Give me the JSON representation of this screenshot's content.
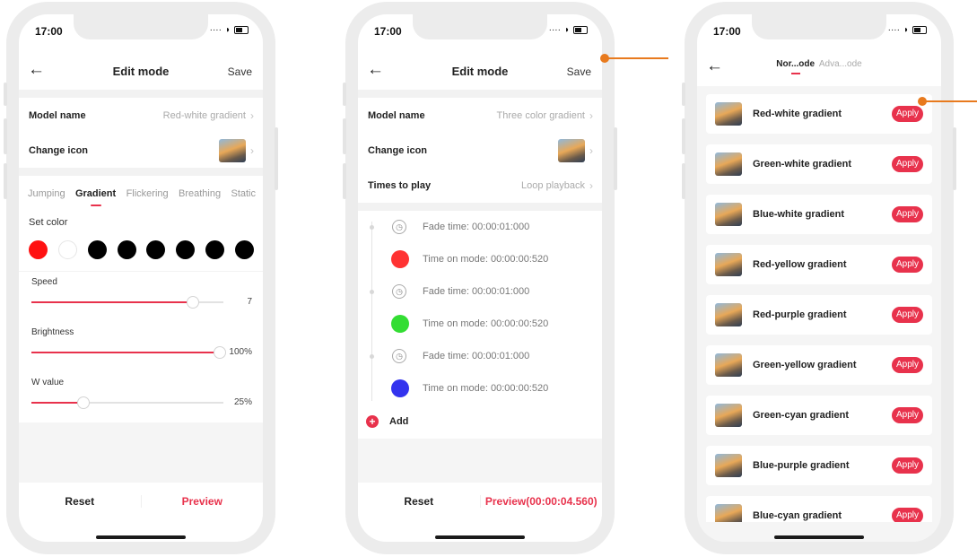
{
  "status": {
    "time": "17:00"
  },
  "phone1": {
    "nav": {
      "back": "←",
      "title": "Edit mode",
      "save": "Save"
    },
    "model_name": {
      "label": "Model name",
      "value": "Red-white gradient"
    },
    "change_icon": {
      "label": "Change icon"
    },
    "tabs": [
      "Jumping",
      "Gradient",
      "Flickering",
      "Breathing",
      "Static"
    ],
    "active_tab": "Gradient",
    "set_color": {
      "label": "Set color",
      "colors": [
        "#ff1111",
        "#ffffff",
        "#000000",
        "#000000",
        "#000000",
        "#000000",
        "#000000",
        "#000000"
      ]
    },
    "speed": {
      "label": "Speed",
      "value": "7",
      "level": 0.84
    },
    "brightness": {
      "label": "Brightness",
      "value": "100%",
      "level": 0.98
    },
    "w_value": {
      "label": "W value",
      "value": "25%",
      "level": 0.27
    },
    "bottom": {
      "reset": "Reset",
      "preview": "Preview"
    }
  },
  "phone2": {
    "nav": {
      "back": "←",
      "title": "Edit mode",
      "save": "Save"
    },
    "model_name": {
      "label": "Model name",
      "value": "Three color gradient"
    },
    "change_icon": {
      "label": "Change icon"
    },
    "times_to_play": {
      "label": "Times to play",
      "value": "Loop playback"
    },
    "timeline": [
      {
        "fade": "Fade time: 00:00:01:000",
        "color": "#ff3333",
        "on": "Time on mode: 00:00:00:520"
      },
      {
        "fade": "Fade time: 00:00:01:000",
        "color": "#33dd33",
        "on": "Time on mode: 00:00:00:520"
      },
      {
        "fade": "Fade time: 00:00:01:000",
        "color": "#3333ee",
        "on": "Time on mode: 00:00:00:520"
      }
    ],
    "add": {
      "icon": "+",
      "label": "Add"
    },
    "bottom": {
      "reset": "Reset",
      "preview": "Preview(00:00:04.560)"
    }
  },
  "phone3": {
    "nav": {
      "back": "←"
    },
    "tabs": {
      "active": "Nor...ode",
      "inactive": "Adva...ode"
    },
    "items": [
      {
        "name": "Red-white gradient",
        "action": "Apply"
      },
      {
        "name": "Green-white gradient",
        "action": "Apply"
      },
      {
        "name": "Blue-white gradient",
        "action": "Apply"
      },
      {
        "name": "Red-yellow gradient",
        "action": "Apply"
      },
      {
        "name": "Red-purple gradient",
        "action": "Apply"
      },
      {
        "name": "Green-yellow gradient",
        "action": "Apply"
      },
      {
        "name": "Green-cyan gradient",
        "action": "Apply"
      },
      {
        "name": "Blue-purple gradient",
        "action": "Apply"
      },
      {
        "name": "Blue-cyan gradient",
        "action": "Apply"
      }
    ]
  },
  "colors": {
    "accent": "#e8324c",
    "callout": "#e87a1e"
  }
}
